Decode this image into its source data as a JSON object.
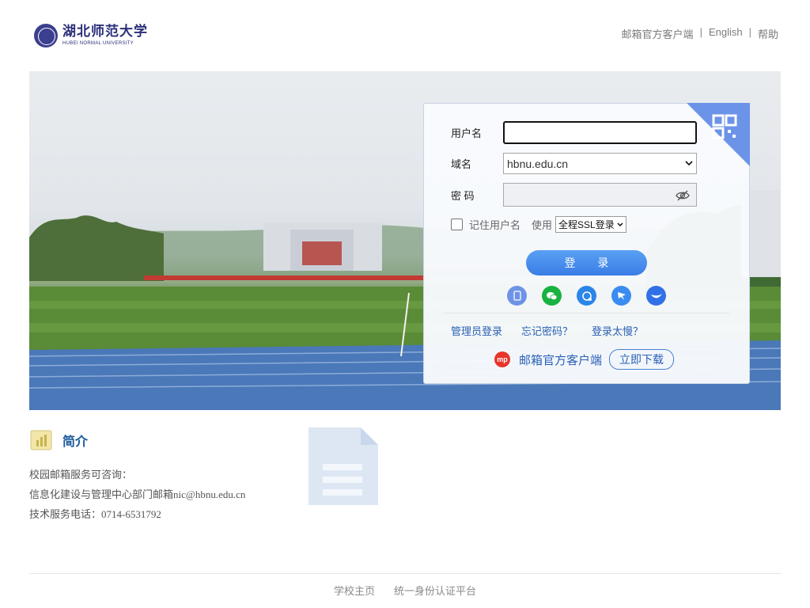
{
  "header": {
    "logo_cn": "湖北师范大学",
    "logo_en": "HUBEI NORMAL UNIVERSITY",
    "links": [
      "邮箱官方客户端",
      "English",
      "帮助"
    ],
    "separator": "|"
  },
  "login": {
    "username_label": "用户名",
    "username_value": "",
    "domain_label": "域名",
    "domain_value": "hbnu.edu.cn",
    "password_label": "密 码",
    "remember_label": "记住用户名",
    "ssl_prefix": "使用",
    "ssl_value": "全程SSL登录",
    "login_button": "登 录",
    "admin_link": "管理员登录",
    "forgot_link": "忘记密码？",
    "slow_link": "登录太慢？",
    "client_logo_text": "mp",
    "client_text": "邮箱官方客户端",
    "download_button": "立即下载",
    "social_icons": [
      "mobile-icon",
      "wechat-icon",
      "qq-icon",
      "dingtalk-icon",
      "feishu-icon"
    ]
  },
  "intro": {
    "title": "简介",
    "lines": [
      "校园邮箱服务可咨询：",
      "信息化建设与管理中心部门邮箱nic@hbnu.edu.cn",
      "技术服务电话：0714-6531792"
    ]
  },
  "footer": {
    "links": [
      "学校主页",
      "统一身份认证平台"
    ]
  },
  "colors": {
    "accent": "#3a7de6",
    "link": "#2a5fb5",
    "title": "#1d5a9c"
  }
}
